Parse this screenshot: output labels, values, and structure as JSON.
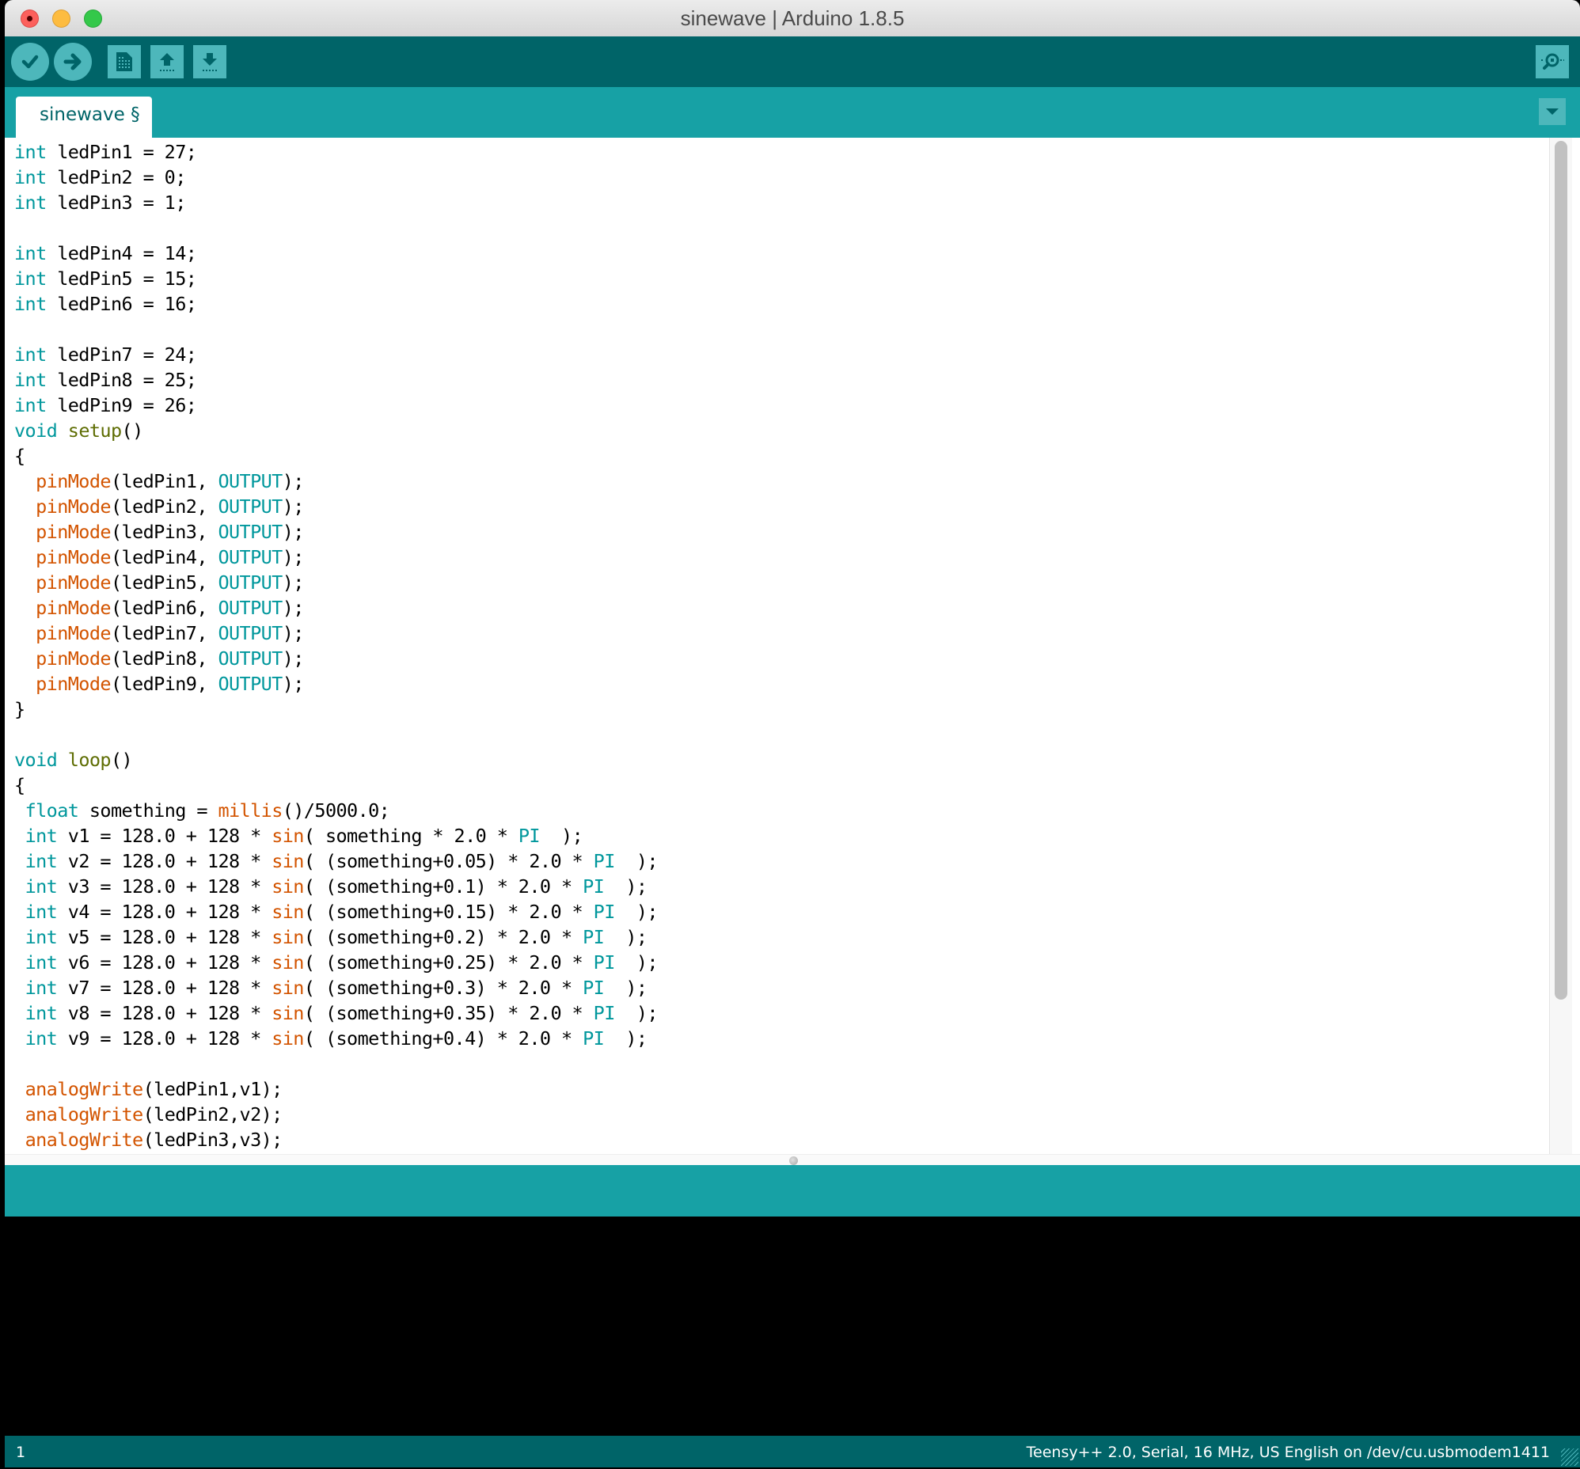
{
  "window": {
    "title": "sinewave | Arduino 1.8.5"
  },
  "toolbar": {
    "buttons": [
      {
        "name": "verify",
        "icon": "check-icon"
      },
      {
        "name": "upload",
        "icon": "arrow-right-icon"
      },
      {
        "name": "new",
        "icon": "new-file-icon"
      },
      {
        "name": "open",
        "icon": "open-arrow-up-icon"
      },
      {
        "name": "save",
        "icon": "save-arrow-down-icon"
      }
    ],
    "serial_monitor_icon": "magnifier-icon"
  },
  "tabs": [
    {
      "label": "sinewave §",
      "active": true
    }
  ],
  "tab_menu_icon": "triangle-down-icon",
  "editor": {
    "lines": [
      [
        [
          "kw",
          "int"
        ],
        [
          "t",
          " ledPin1 = 27;"
        ]
      ],
      [
        [
          "kw",
          "int"
        ],
        [
          "t",
          " ledPin2 = 0;"
        ]
      ],
      [
        [
          "kw",
          "int"
        ],
        [
          "t",
          " ledPin3 = 1;"
        ]
      ],
      [],
      [
        [
          "kw",
          "int"
        ],
        [
          "t",
          " ledPin4 = 14;"
        ]
      ],
      [
        [
          "kw",
          "int"
        ],
        [
          "t",
          " ledPin5 = 15;"
        ]
      ],
      [
        [
          "kw",
          "int"
        ],
        [
          "t",
          " ledPin6 = 16;"
        ]
      ],
      [],
      [
        [
          "kw",
          "int"
        ],
        [
          "t",
          " ledPin7 = 24;"
        ]
      ],
      [
        [
          "kw",
          "int"
        ],
        [
          "t",
          " ledPin8 = 25;"
        ]
      ],
      [
        [
          "kw",
          "int"
        ],
        [
          "t",
          " ledPin9 = 26;"
        ]
      ],
      [
        [
          "kw",
          "void"
        ],
        [
          "t",
          " "
        ],
        [
          "st",
          "setup"
        ],
        [
          "t",
          "()"
        ]
      ],
      [
        [
          "t",
          "{"
        ]
      ],
      [
        [
          "t",
          "  "
        ],
        [
          "fn",
          "pinMode"
        ],
        [
          "t",
          "(ledPin1, "
        ],
        [
          "cn",
          "OUTPUT"
        ],
        [
          "t",
          ");"
        ]
      ],
      [
        [
          "t",
          "  "
        ],
        [
          "fn",
          "pinMode"
        ],
        [
          "t",
          "(ledPin2, "
        ],
        [
          "cn",
          "OUTPUT"
        ],
        [
          "t",
          ");"
        ]
      ],
      [
        [
          "t",
          "  "
        ],
        [
          "fn",
          "pinMode"
        ],
        [
          "t",
          "(ledPin3, "
        ],
        [
          "cn",
          "OUTPUT"
        ],
        [
          "t",
          ");"
        ]
      ],
      [
        [
          "t",
          "  "
        ],
        [
          "fn",
          "pinMode"
        ],
        [
          "t",
          "(ledPin4, "
        ],
        [
          "cn",
          "OUTPUT"
        ],
        [
          "t",
          ");"
        ]
      ],
      [
        [
          "t",
          "  "
        ],
        [
          "fn",
          "pinMode"
        ],
        [
          "t",
          "(ledPin5, "
        ],
        [
          "cn",
          "OUTPUT"
        ],
        [
          "t",
          ");"
        ]
      ],
      [
        [
          "t",
          "  "
        ],
        [
          "fn",
          "pinMode"
        ],
        [
          "t",
          "(ledPin6, "
        ],
        [
          "cn",
          "OUTPUT"
        ],
        [
          "t",
          ");"
        ]
      ],
      [
        [
          "t",
          "  "
        ],
        [
          "fn",
          "pinMode"
        ],
        [
          "t",
          "(ledPin7, "
        ],
        [
          "cn",
          "OUTPUT"
        ],
        [
          "t",
          ");"
        ]
      ],
      [
        [
          "t",
          "  "
        ],
        [
          "fn",
          "pinMode"
        ],
        [
          "t",
          "(ledPin8, "
        ],
        [
          "cn",
          "OUTPUT"
        ],
        [
          "t",
          ");"
        ]
      ],
      [
        [
          "t",
          "  "
        ],
        [
          "fn",
          "pinMode"
        ],
        [
          "t",
          "(ledPin9, "
        ],
        [
          "cn",
          "OUTPUT"
        ],
        [
          "t",
          ");"
        ]
      ],
      [
        [
          "t",
          "}"
        ]
      ],
      [],
      [
        [
          "kw",
          "void"
        ],
        [
          "t",
          " "
        ],
        [
          "st",
          "loop"
        ],
        [
          "t",
          "()"
        ]
      ],
      [
        [
          "t",
          "{"
        ]
      ],
      [
        [
          "t",
          " "
        ],
        [
          "kw",
          "float"
        ],
        [
          "t",
          " something = "
        ],
        [
          "fn",
          "millis"
        ],
        [
          "t",
          "()/5000.0;"
        ]
      ],
      [
        [
          "t",
          " "
        ],
        [
          "kw",
          "int"
        ],
        [
          "t",
          " v1 = 128.0 + 128 * "
        ],
        [
          "fn",
          "sin"
        ],
        [
          "t",
          "( something * 2.0 * "
        ],
        [
          "cn",
          "PI"
        ],
        [
          "t",
          "  );"
        ]
      ],
      [
        [
          "t",
          " "
        ],
        [
          "kw",
          "int"
        ],
        [
          "t",
          " v2 = 128.0 + 128 * "
        ],
        [
          "fn",
          "sin"
        ],
        [
          "t",
          "( (something+0.05) * 2.0 * "
        ],
        [
          "cn",
          "PI"
        ],
        [
          "t",
          "  );"
        ]
      ],
      [
        [
          "t",
          " "
        ],
        [
          "kw",
          "int"
        ],
        [
          "t",
          " v3 = 128.0 + 128 * "
        ],
        [
          "fn",
          "sin"
        ],
        [
          "t",
          "( (something+0.1) * 2.0 * "
        ],
        [
          "cn",
          "PI"
        ],
        [
          "t",
          "  );"
        ]
      ],
      [
        [
          "t",
          " "
        ],
        [
          "kw",
          "int"
        ],
        [
          "t",
          " v4 = 128.0 + 128 * "
        ],
        [
          "fn",
          "sin"
        ],
        [
          "t",
          "( (something+0.15) * 2.0 * "
        ],
        [
          "cn",
          "PI"
        ],
        [
          "t",
          "  );"
        ]
      ],
      [
        [
          "t",
          " "
        ],
        [
          "kw",
          "int"
        ],
        [
          "t",
          " v5 = 128.0 + 128 * "
        ],
        [
          "fn",
          "sin"
        ],
        [
          "t",
          "( (something+0.2) * 2.0 * "
        ],
        [
          "cn",
          "PI"
        ],
        [
          "t",
          "  );"
        ]
      ],
      [
        [
          "t",
          " "
        ],
        [
          "kw",
          "int"
        ],
        [
          "t",
          " v6 = 128.0 + 128 * "
        ],
        [
          "fn",
          "sin"
        ],
        [
          "t",
          "( (something+0.25) * 2.0 * "
        ],
        [
          "cn",
          "PI"
        ],
        [
          "t",
          "  );"
        ]
      ],
      [
        [
          "t",
          " "
        ],
        [
          "kw",
          "int"
        ],
        [
          "t",
          " v7 = 128.0 + 128 * "
        ],
        [
          "fn",
          "sin"
        ],
        [
          "t",
          "( (something+0.3) * 2.0 * "
        ],
        [
          "cn",
          "PI"
        ],
        [
          "t",
          "  );"
        ]
      ],
      [
        [
          "t",
          " "
        ],
        [
          "kw",
          "int"
        ],
        [
          "t",
          " v8 = 128.0 + 128 * "
        ],
        [
          "fn",
          "sin"
        ],
        [
          "t",
          "( (something+0.35) * 2.0 * "
        ],
        [
          "cn",
          "PI"
        ],
        [
          "t",
          "  );"
        ]
      ],
      [
        [
          "t",
          " "
        ],
        [
          "kw",
          "int"
        ],
        [
          "t",
          " v9 = 128.0 + 128 * "
        ],
        [
          "fn",
          "sin"
        ],
        [
          "t",
          "( (something+0.4) * 2.0 * "
        ],
        [
          "cn",
          "PI"
        ],
        [
          "t",
          "  );"
        ]
      ],
      [],
      [
        [
          "t",
          " "
        ],
        [
          "fn",
          "analogWrite"
        ],
        [
          "t",
          "(ledPin1,v1);"
        ]
      ],
      [
        [
          "t",
          " "
        ],
        [
          "fn",
          "analogWrite"
        ],
        [
          "t",
          "(ledPin2,v2);"
        ]
      ],
      [
        [
          "t",
          " "
        ],
        [
          "fn",
          "analogWrite"
        ],
        [
          "t",
          "(ledPin3,v3);"
        ]
      ]
    ]
  },
  "message_area": "",
  "console_output": "",
  "status_bar": {
    "line_number": "1",
    "board_info": "Teensy++ 2.0, Serial, 16 MHz, US English on /dev/cu.usbmodem1411"
  },
  "colors": {
    "toolbar_bg": "#006468",
    "tabbar_bg": "#17a1a5",
    "button_bg": "#4db7bb",
    "keyword": "#00979c",
    "function": "#d35400",
    "structure": "#5e6d03"
  }
}
